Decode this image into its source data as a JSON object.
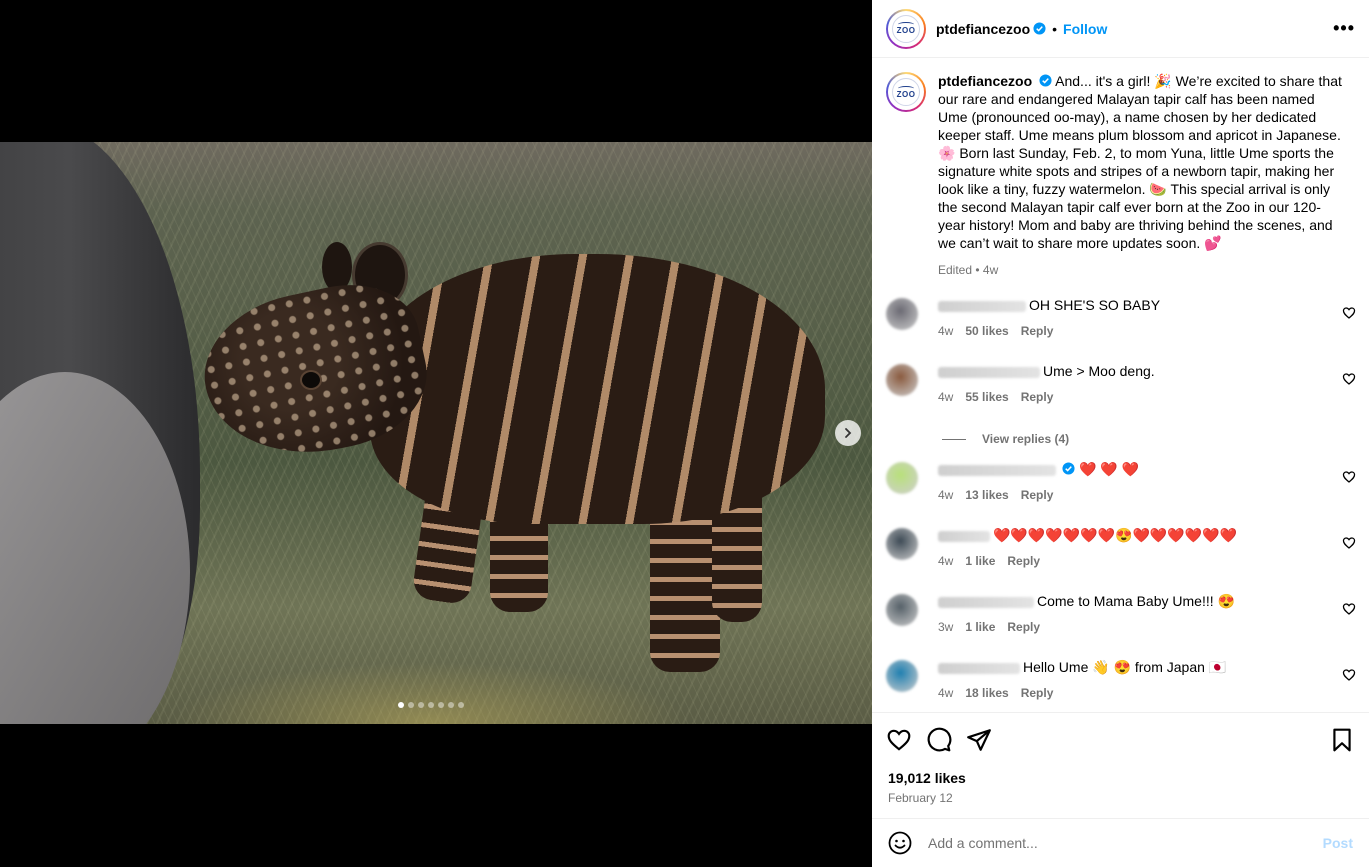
{
  "post": {
    "username": "ptdefiancezoo",
    "follow_label": "Follow",
    "separator": "•",
    "more_label": "•••",
    "logo_text": "ZOO",
    "caption": "And... it's a girl! 🎉 We’re excited to share that our rare and endangered Malayan tapir calf has been named Ume (pronounced oo-may), a name chosen by her dedicated keeper staff. Ume means plum blossom and apricot in Japanese. 🌸 Born last Sunday, Feb. 2, to mom Yuna, little Ume sports the signature white spots and stripes of a newborn tapir, making her look like a tiny, fuzzy watermelon. 🍉 This special arrival is only the second Malayan tapir calf ever born at the Zoo in our 120-year history! Mom and baby are thriving behind the scenes, and we can’t wait to share more updates soon. 💕",
    "caption_meta": "Edited • 4w",
    "likes": "19,012 likes",
    "date": "February 12",
    "carousel": {
      "slide_count": 7,
      "active_index": 0
    }
  },
  "comments": [
    {
      "text": "OH SHE'S SO BABY",
      "age": "4w",
      "likes": "50 likes",
      "reply": "Reply",
      "avatar_color": "#6b6a73",
      "verified": false
    },
    {
      "text": "Ume > Moo deng.",
      "age": "4w",
      "likes": "55 likes",
      "reply": "Reply",
      "avatar_color": "#8a5a3e",
      "verified": false,
      "replies": "View replies (4)"
    },
    {
      "text": "❤️ ❤️ ❤️",
      "age": "4w",
      "likes": "13 likes",
      "reply": "Reply",
      "avatar_color": "#b8e07a",
      "verified": true
    },
    {
      "text": "❤️❤️❤️❤️❤️❤️❤️😍❤️❤️❤️❤️❤️❤️",
      "age": "4w",
      "likes": "1 like",
      "reply": "Reply",
      "avatar_color": "#3d4a55",
      "verified": false
    },
    {
      "text": "Come to Mama Baby Ume!!! 😍",
      "age": "3w",
      "likes": "1 like",
      "reply": "Reply",
      "avatar_color": "#556068",
      "verified": false
    },
    {
      "text": "Hello Ume 👋 😍 from Japan 🇯🇵",
      "age": "4w",
      "likes": "18 likes",
      "reply": "Reply",
      "avatar_color": "#1f7fb0",
      "verified": false
    }
  ],
  "composer": {
    "placeholder": "Add a comment...",
    "post_label": "Post"
  },
  "colors": {
    "accent": "#0095f6",
    "muted": "#737373",
    "post_disabled": "#b3dbff"
  }
}
